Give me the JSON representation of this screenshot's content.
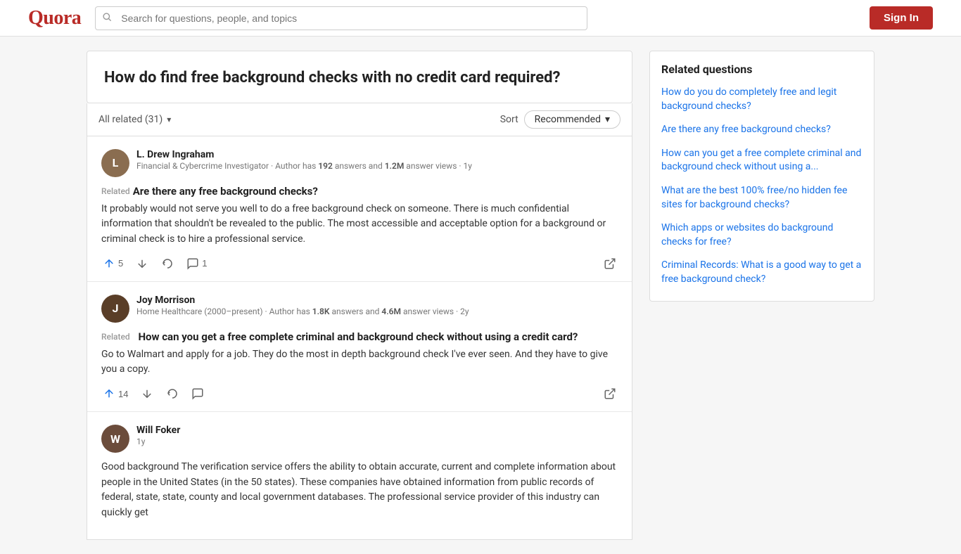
{
  "header": {
    "logo": "Quora",
    "search_placeholder": "Search for questions, people, and topics",
    "sign_in_label": "Sign In"
  },
  "main_question": {
    "title": "How do find free background checks with no credit card required?"
  },
  "filter_bar": {
    "all_related_label": "All related (31)",
    "sort_label": "Sort",
    "recommended_label": "Recommended"
  },
  "answers": [
    {
      "id": "answer-1",
      "author_name": "L. Drew Ingraham",
      "author_meta": "Financial & Cybercrime Investigator · Author has 192 answers and 1.2M answer views · 1y",
      "author_initials": "L",
      "avatar_class": "avatar-1",
      "related_label": "Related",
      "related_question": "Are there any free background checks?",
      "answer_text": "It probably would not serve you well to do a free background check on someone. There is much confidential information that shouldn't be revealed to the public. The most accessible and acceptable option for a background or criminal check is to hire a professional service.",
      "upvote_count": "5",
      "comment_count": "1"
    },
    {
      "id": "answer-2",
      "author_name": "Joy Morrison",
      "author_meta": "Home Healthcare (2000–present) · Author has 1.8K answers and 4.6M answer views · 2y",
      "author_initials": "J",
      "avatar_class": "avatar-2",
      "related_label": "Related",
      "related_question": "How can you get a free complete criminal and background check without using a credit card?",
      "answer_text": "Go to Walmart and apply for a job. They do the most in depth background check I've ever seen. And they have to give you a copy.",
      "upvote_count": "14",
      "comment_count": ""
    },
    {
      "id": "answer-3",
      "author_name": "Will Foker",
      "author_meta": "1y",
      "author_initials": "W",
      "avatar_class": "avatar-3",
      "related_label": "",
      "related_question": "",
      "answer_text": "Good background The verification service offers the ability to obtain accurate, current and complete information about people in the United States (in the 50 states). These companies have obtained information from public records of federal, state, state, county and local government databases. The professional service provider of this industry can quickly get",
      "upvote_count": "",
      "comment_count": ""
    }
  ],
  "sidebar": {
    "title": "Related questions",
    "links": [
      "How do you do completely free and legit background checks?",
      "Are there any free background checks?",
      "How can you get a free complete criminal and background check without using a...",
      "What are the best 100% free/no hidden fee sites for background checks?",
      "Which apps or websites do background checks for free?",
      "Criminal Records: What is a good way to get a free background check?"
    ]
  }
}
